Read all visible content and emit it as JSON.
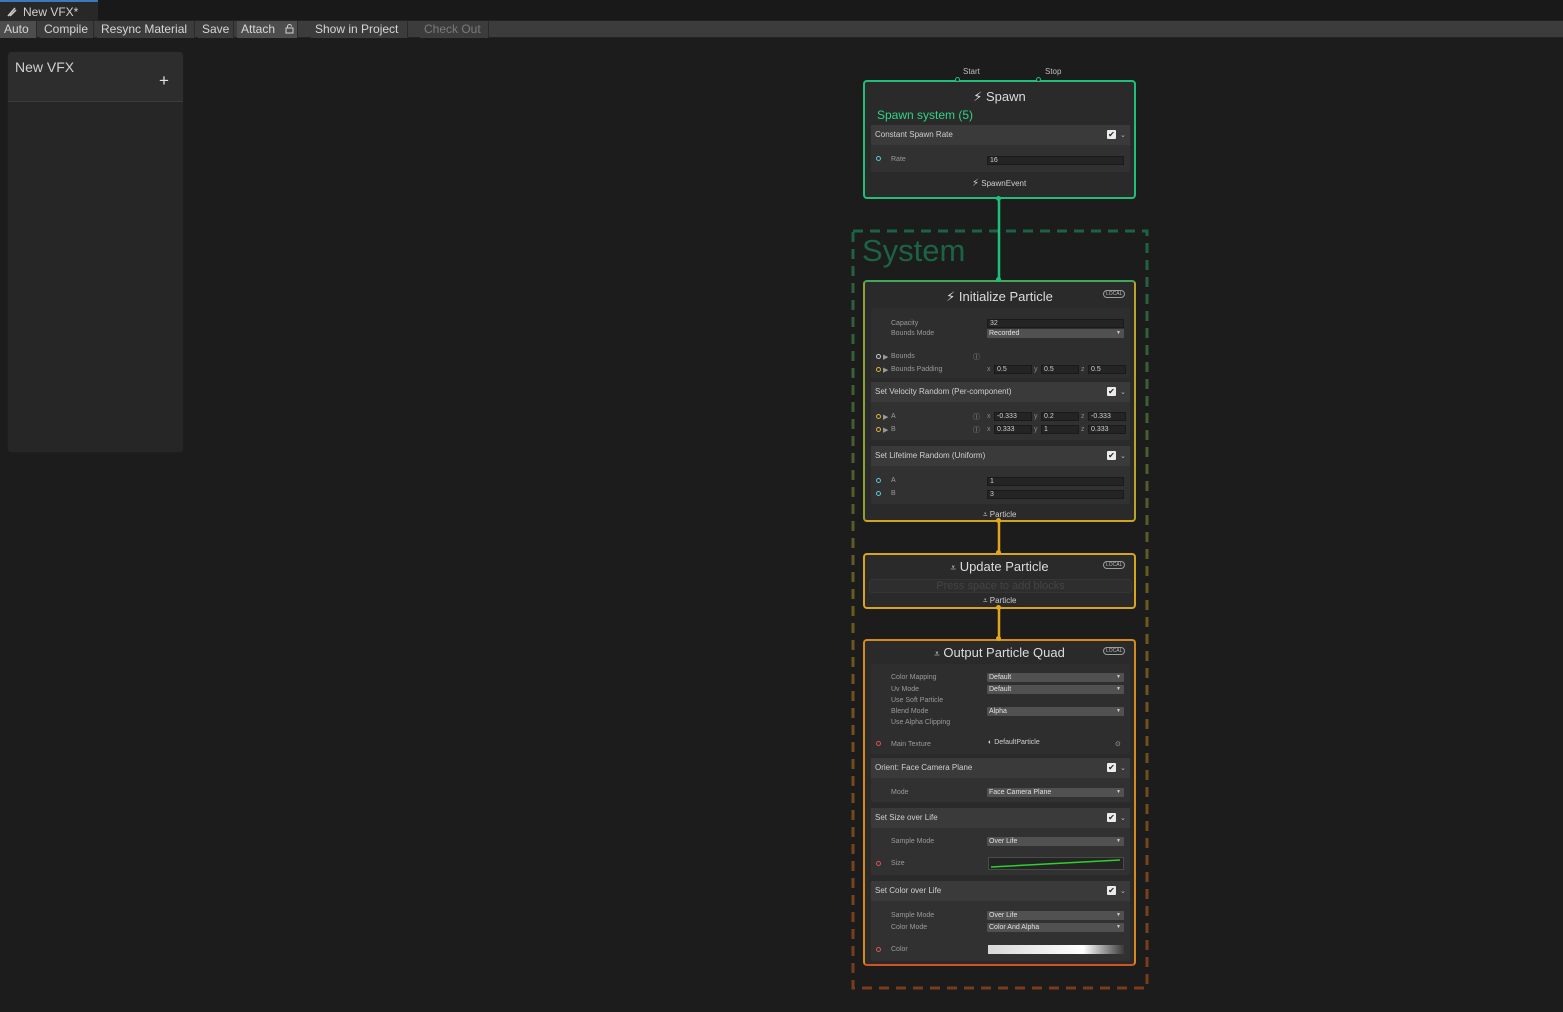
{
  "window": {
    "tab_title": "New VFX*"
  },
  "toolbar": {
    "auto": "Auto",
    "compile": "Compile",
    "resync": "Resync Material",
    "save": "Save",
    "attach": "Attach",
    "show_in_project": "Show in Project",
    "check_out": "Check Out"
  },
  "blackboard": {
    "title": "New VFX",
    "add": "+"
  },
  "system": {
    "title": "System"
  },
  "spawn": {
    "port_start": "Start",
    "port_stop": "Stop",
    "title": "Spawn",
    "subtitle": "Spawn system (5)",
    "block_title": "Constant Spawn Rate",
    "rate_label": "Rate",
    "rate_value": "16",
    "output_label": "SpawnEvent"
  },
  "init": {
    "title": "Initialize Particle",
    "badge": "LOCAL",
    "capacity_label": "Capacity",
    "capacity_value": "32",
    "bounds_mode_label": "Bounds Mode",
    "bounds_mode_value": "Recorded",
    "bounds_label": "Bounds",
    "bounds_padding_label": "Bounds Padding",
    "bp_x": "0.5",
    "bp_y": "0.5",
    "bp_z": "0.5",
    "velocity_title": "Set Velocity Random (Per-component)",
    "vel_a_label": "A",
    "vel_a": {
      "x": "-0.333",
      "y": "0.2",
      "z": "-0.333"
    },
    "vel_b_label": "B",
    "vel_b": {
      "x": "0.333",
      "y": "1",
      "z": "0.333"
    },
    "lifetime_title": "Set Lifetime Random (Uniform)",
    "life_a_label": "A",
    "life_a_value": "1",
    "life_b_label": "B",
    "life_b_value": "3",
    "output_label": "Particle"
  },
  "update": {
    "title": "Update Particle",
    "badge": "LOCAL",
    "placeholder": "Press space to add blocks",
    "output_label": "Particle"
  },
  "output": {
    "title": "Output Particle Quad",
    "badge": "LOCAL",
    "color_mapping_label": "Color Mapping",
    "color_mapping_value": "Default",
    "uv_mode_label": "Uv Mode",
    "uv_mode_value": "Default",
    "soft_particle_label": "Use Soft Particle",
    "blend_mode_label": "Blend Mode",
    "blend_mode_value": "Alpha",
    "alpha_clip_label": "Use Alpha Clipping",
    "main_texture_label": "Main Texture",
    "main_texture_value": "DefaultParticle",
    "orient_title": "Orient: Face Camera Plane",
    "mode_label": "Mode",
    "mode_value": "Face Camera Plane",
    "size_title": "Set Size over Life",
    "size_sample_label": "Sample Mode",
    "size_sample_value": "Over Life",
    "size_label": "Size",
    "color_title": "Set Color over Life",
    "color_sample_label": "Sample Mode",
    "color_sample_value": "Over Life",
    "color_mode_label": "Color Mode",
    "color_mode_value": "Color And Alpha",
    "color_label": "Color"
  },
  "colors": {
    "spawn": "#1fbf7a",
    "init": "#d2a320",
    "update": "#d7a41f",
    "output": "#d2651e",
    "system_border_top": "#1b6344",
    "system_border_bottom": "#7a3a1c"
  }
}
